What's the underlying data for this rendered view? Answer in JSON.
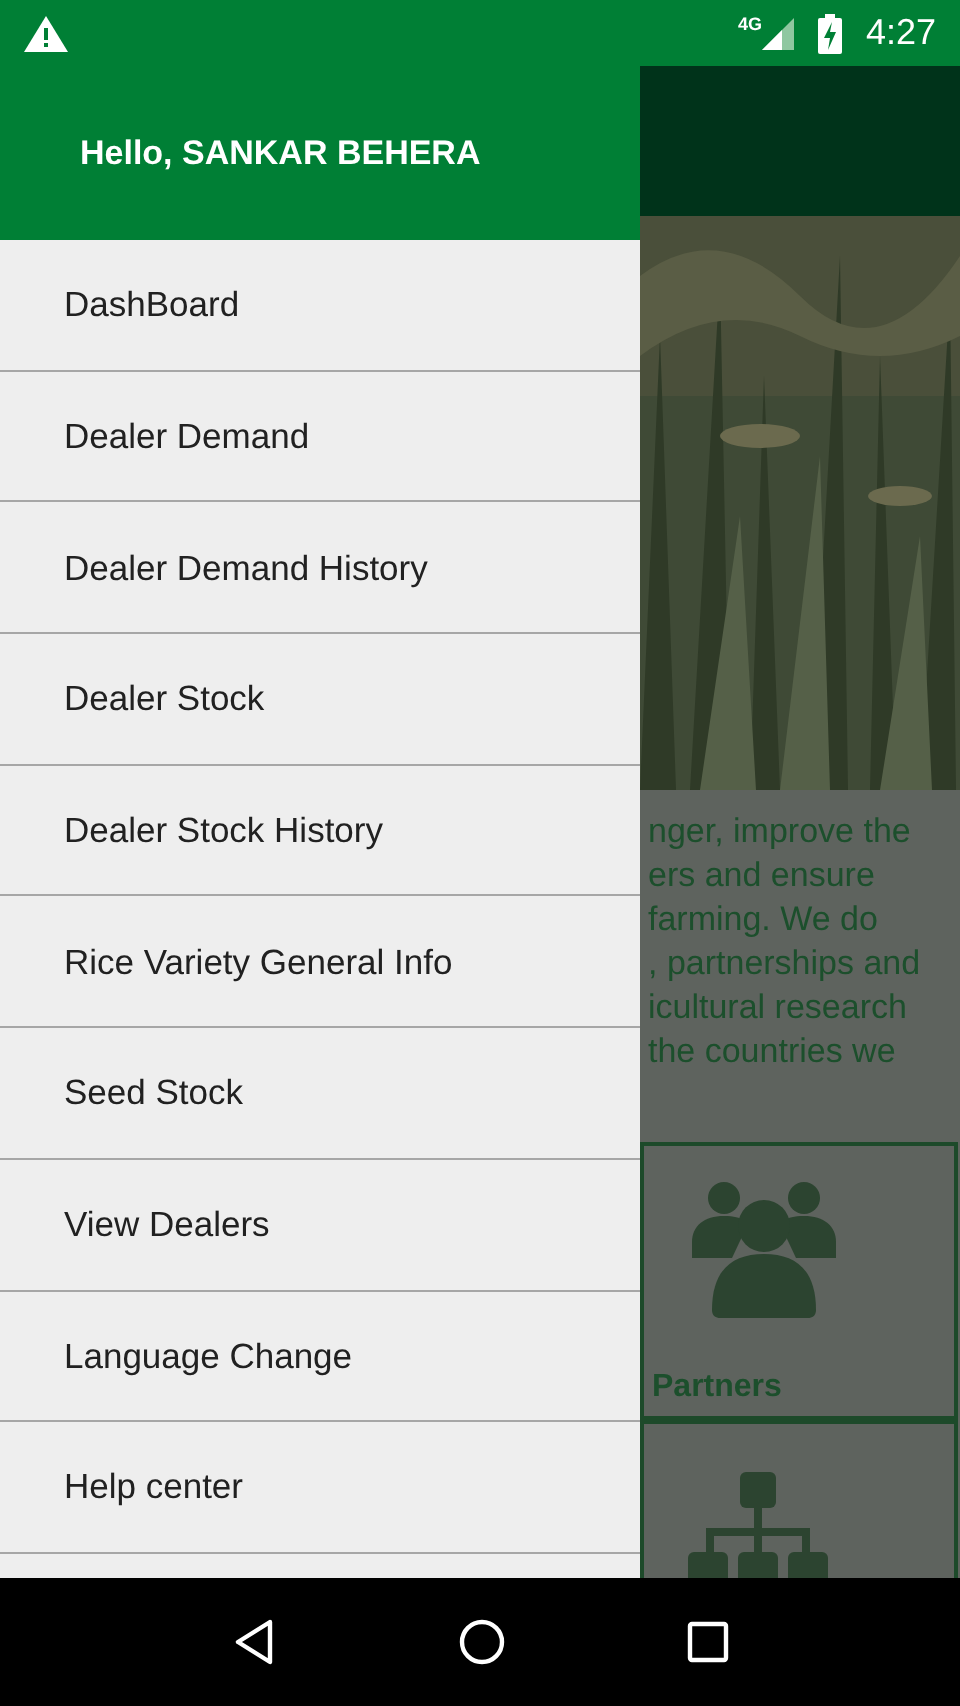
{
  "status_bar": {
    "network": "4G",
    "time": "4:27"
  },
  "drawer": {
    "greeting": "Hello, SANKAR BEHERA",
    "items": [
      {
        "label": "DashBoard"
      },
      {
        "label": "Dealer Demand"
      },
      {
        "label": "Dealer Demand History"
      },
      {
        "label": "Dealer Stock"
      },
      {
        "label": "Dealer Stock History"
      },
      {
        "label": "Rice Variety General Info"
      },
      {
        "label": "Seed Stock"
      },
      {
        "label": "View Dealers"
      },
      {
        "label": "Language Change"
      },
      {
        "label": "Help center"
      }
    ]
  },
  "background": {
    "about_lines": [
      "nger, improve the",
      "ers and ensure",
      "farming. We do",
      ", partnerships and",
      "icultural research",
      "the countries we"
    ],
    "cards": [
      {
        "kind": "people",
        "label": "Partners"
      },
      {
        "kind": "hierarchy"
      }
    ]
  }
}
